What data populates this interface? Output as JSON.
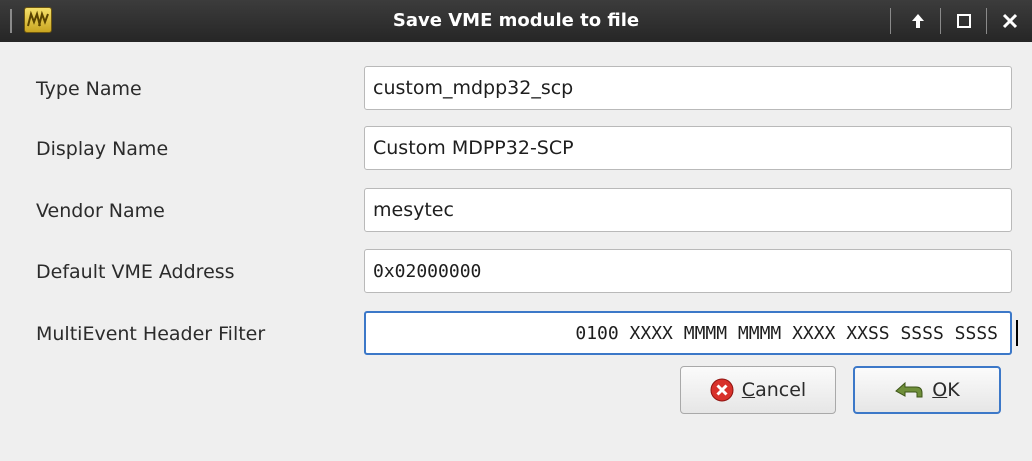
{
  "window": {
    "title": "Save VME module to file"
  },
  "titlebar_buttons": {
    "keep_above_icon": "up-arrow-icon",
    "maximize_icon": "maximize-icon",
    "close_icon": "close-icon"
  },
  "form": {
    "rows": [
      {
        "label": "Type Name",
        "value": "custom_mdpp32_scp"
      },
      {
        "label": "Display Name",
        "value": "Custom MDPP32-SCP"
      },
      {
        "label": "Vendor Name",
        "value": "mesytec"
      },
      {
        "label": "Default VME Address",
        "value": "0x02000000"
      },
      {
        "label": "MultiEvent Header Filter",
        "value": "0100 XXXX MMMM MMMM XXXX XXSS SSSS SSSS"
      }
    ]
  },
  "buttons": {
    "cancel": {
      "mnemonic": "C",
      "rest": "ancel",
      "icon": "cancel-icon"
    },
    "ok": {
      "mnemonic": "O",
      "rest": "K",
      "icon": "ok-arrow-icon"
    }
  },
  "colors": {
    "titlebar": "#2f2f2f",
    "focus": "#3c78c8",
    "dialog_bg": "#efefef",
    "cancel_icon": "#d8312b",
    "ok_icon": "#6f8f3a"
  }
}
